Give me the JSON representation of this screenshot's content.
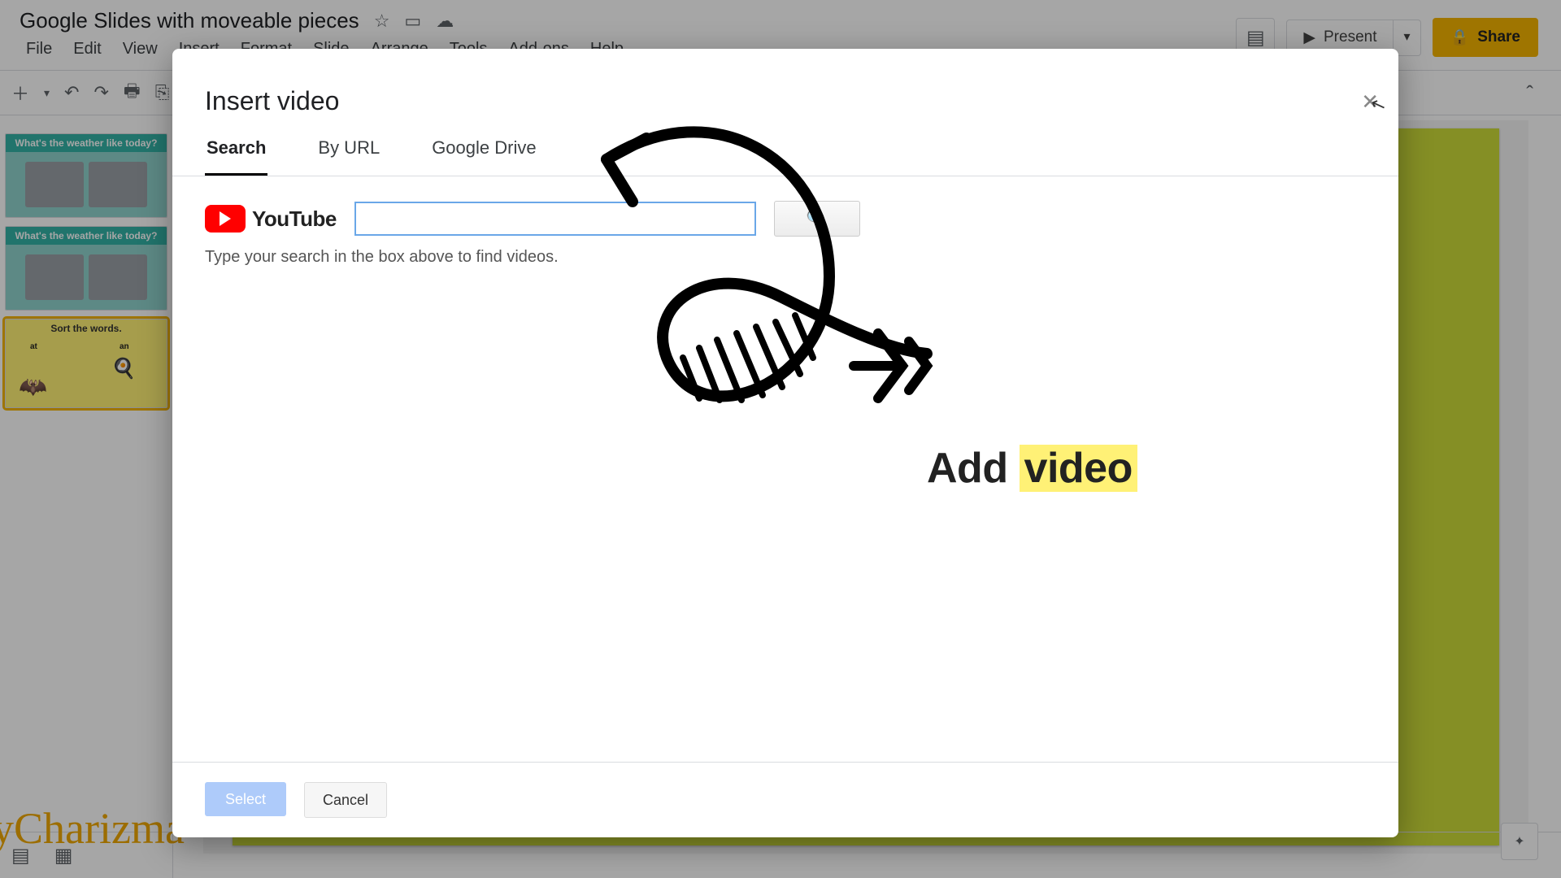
{
  "doc": {
    "title": "Google Slides with moveable pieces"
  },
  "menus": [
    "File",
    "Edit",
    "View",
    "Insert",
    "Format",
    "Slide",
    "Arrange",
    "Tools",
    "Add-ons",
    "Help"
  ],
  "topbar": {
    "present": "Present",
    "share": "Share"
  },
  "thumbs": {
    "weather": "What's the weather like today?",
    "sort": "Sort the words.",
    "cat": "at",
    "can": "an"
  },
  "dialog": {
    "title": "Insert video",
    "tabs": {
      "search": "Search",
      "byurl": "By URL",
      "drive": "Google Drive"
    },
    "youtube": "YouTube",
    "search_value": "",
    "hint": "Type your search in the box above to find videos.",
    "select": "Select",
    "cancel": "Cancel"
  },
  "annotation": {
    "add": "Add ",
    "video": "video"
  },
  "watermark": "yCharizma"
}
